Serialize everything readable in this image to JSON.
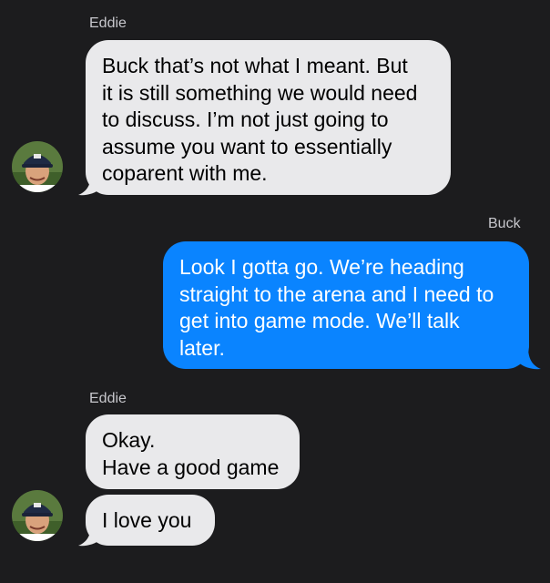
{
  "colors": {
    "background": "#1c1c1e",
    "incoming_bubble": "#e9e9eb",
    "outgoing_bubble": "#0a84ff",
    "sender_label": "#c7c7cc"
  },
  "messages": [
    {
      "sender": "Eddie",
      "direction": "incoming",
      "text": "Buck that’s not what I meant. But\nit is still something we would need\nto discuss. I’m not just going to\nassume you want to essentially\ncoparent with me."
    },
    {
      "sender": "Buck",
      "direction": "outgoing",
      "text": "Look I gotta go. We’re heading\nstraight to the arena and I need to\nget into game mode. We’ll talk\nlater."
    },
    {
      "sender": "Eddie",
      "direction": "incoming",
      "text": "Okay.\nHave a good game"
    },
    {
      "sender": "Eddie",
      "direction": "incoming",
      "text": "I love you"
    }
  ],
  "avatar_icon": "contact-photo-icon"
}
